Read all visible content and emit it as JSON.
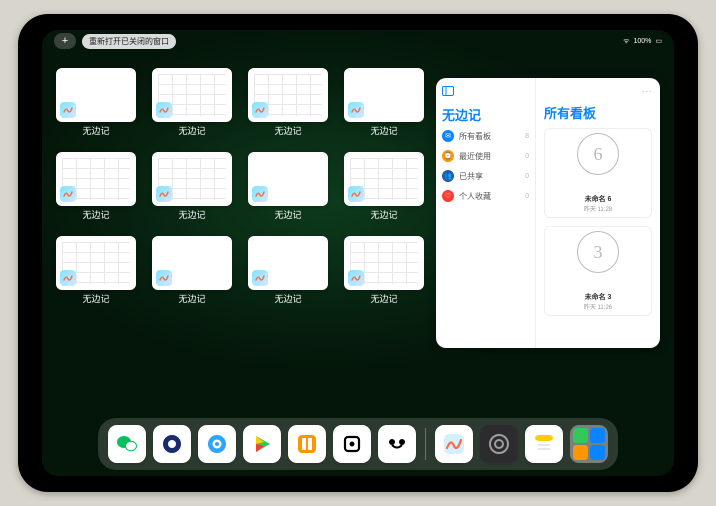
{
  "status": {
    "time": "",
    "battery_label": "100%",
    "add_glyph": "+"
  },
  "reopen": {
    "label": "重新打开已关闭的窗口"
  },
  "thumbs": {
    "label": "无边记",
    "items": [
      {
        "hasGrid": false
      },
      {
        "hasGrid": true
      },
      {
        "hasGrid": true
      },
      {
        "hasGrid": false
      },
      {
        "hasGrid": true
      },
      {
        "hasGrid": true
      },
      {
        "hasGrid": false
      },
      {
        "hasGrid": true
      },
      {
        "hasGrid": true
      },
      {
        "hasGrid": false
      },
      {
        "hasGrid": false
      },
      {
        "hasGrid": true
      }
    ]
  },
  "sidepanel": {
    "left_title": "无边记",
    "items": [
      {
        "icon": "message",
        "color": "blue",
        "label": "所有看板",
        "count": 8
      },
      {
        "icon": "recent",
        "color": "orange",
        "label": "最近使用",
        "count": 0
      },
      {
        "icon": "shared",
        "color": "navy",
        "label": "已共享",
        "count": 0
      },
      {
        "icon": "fav",
        "color": "red",
        "label": "个人收藏",
        "count": 0
      }
    ],
    "right_title": "所有看板",
    "boards": [
      {
        "sketch": "6",
        "name": "未命名 6",
        "sub": "昨天 11:28"
      },
      {
        "sketch": "3",
        "name": "未命名 3",
        "sub": "昨天 11:26"
      }
    ],
    "more": "···"
  },
  "dock": {
    "apps": [
      {
        "name": "wechat",
        "bg": "white"
      },
      {
        "name": "quark",
        "bg": "white"
      },
      {
        "name": "browser",
        "bg": "white"
      },
      {
        "name": "play",
        "bg": "white"
      },
      {
        "name": "books",
        "bg": "white"
      },
      {
        "name": "obsidian",
        "bg": "white"
      },
      {
        "name": "app7",
        "bg": "white"
      }
    ],
    "recent": [
      {
        "name": "freeform",
        "bg": "white"
      },
      {
        "name": "settings",
        "bg": "dark"
      },
      {
        "name": "notes",
        "bg": "white"
      }
    ]
  }
}
